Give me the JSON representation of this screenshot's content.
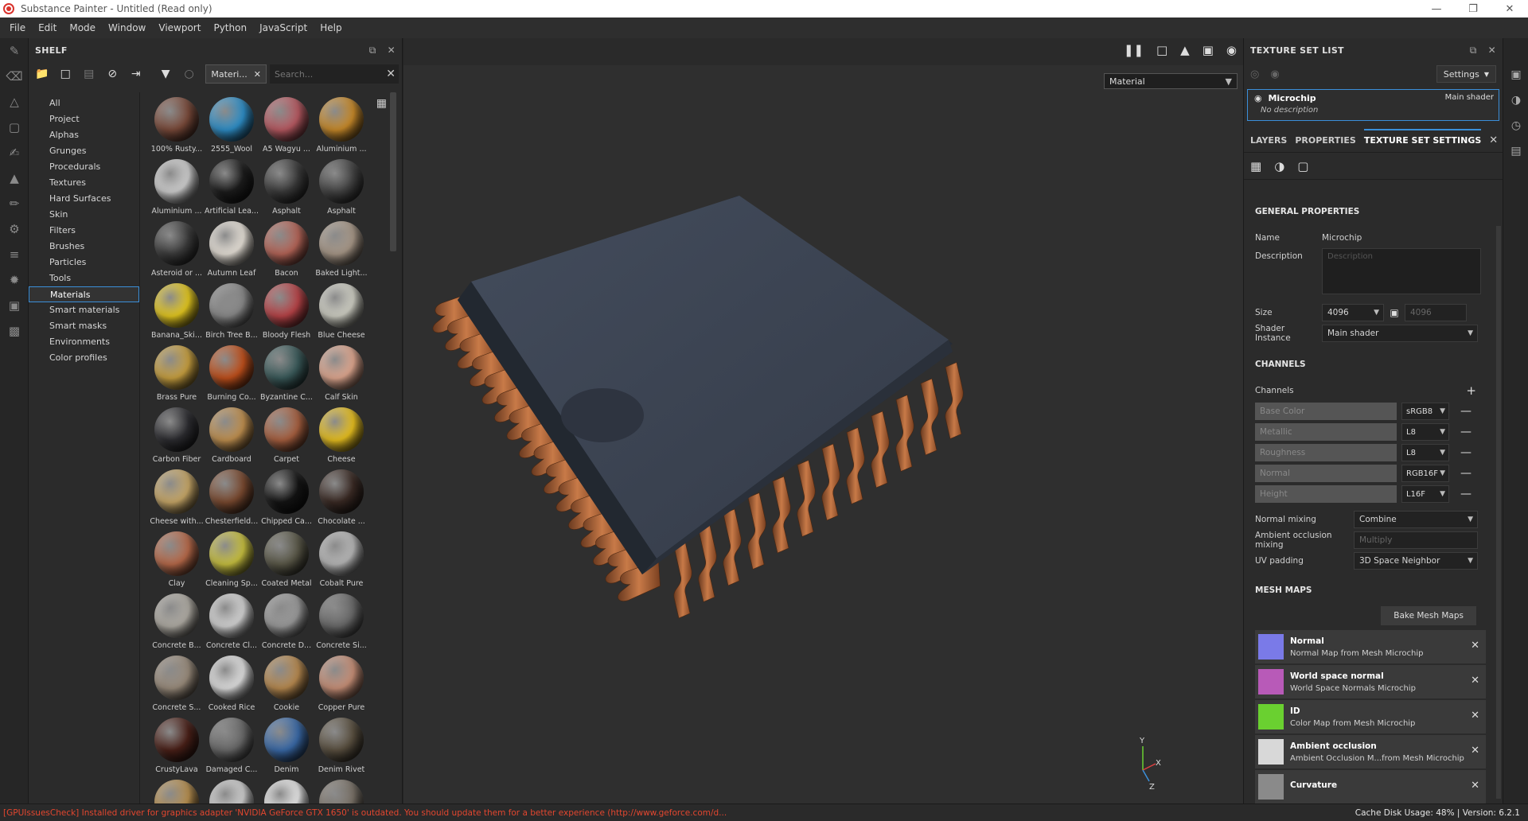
{
  "window": {
    "title": "Substance Painter - Untitled (Read only)"
  },
  "menu": [
    "File",
    "Edit",
    "Mode",
    "Window",
    "Viewport",
    "Python",
    "JavaScript",
    "Help"
  ],
  "shelf": {
    "title": "SHELF",
    "filter_chip": "Materi...",
    "search_placeholder": "Search...",
    "categories": [
      "All",
      "Project",
      "Alphas",
      "Grunges",
      "Procedurals",
      "Textures",
      "Hard Surfaces",
      "Skin",
      "Filters",
      "Brushes",
      "Particles",
      "Tools",
      "Materials",
      "Smart materials",
      "Smart masks",
      "Environments",
      "Color profiles"
    ],
    "active_category": "Materials",
    "materials": [
      {
        "label": "100% Rusty...",
        "color": "#7a4a3a"
      },
      {
        "label": "2555_Wool",
        "color": "#2f8fc8"
      },
      {
        "label": "A5 Wagyu ...",
        "color": "#b85a62"
      },
      {
        "label": "Aluminium ...",
        "color": "#c88a2a"
      },
      {
        "label": "Aluminium ...",
        "color": "#cfcfcf"
      },
      {
        "label": "Artificial Lea...",
        "color": "#1c1c1c"
      },
      {
        "label": "Asphalt",
        "color": "#3a3a3a"
      },
      {
        "label": "Asphalt",
        "color": "#444444"
      },
      {
        "label": "Asteroid or ...",
        "color": "#3c3c3c"
      },
      {
        "label": "Autumn Leaf",
        "color": "#e7e1d8"
      },
      {
        "label": "Bacon",
        "color": "#b56558"
      },
      {
        "label": "Baked Light...",
        "color": "#a89888"
      },
      {
        "label": "Banana_Ski...",
        "color": "#e4c820"
      },
      {
        "label": "Birch Tree B...",
        "color": "#8a8a8a"
      },
      {
        "label": "Bloody Flesh",
        "color": "#b84448"
      },
      {
        "label": "Blue Cheese",
        "color": "#cfcfc4"
      },
      {
        "label": "Brass Pure",
        "color": "#c8a040"
      },
      {
        "label": "Burning Co...",
        "color": "#c0501c"
      },
      {
        "label": "Byzantine C...",
        "color": "#3a5a5a"
      },
      {
        "label": "Calf Skin",
        "color": "#e0a890"
      },
      {
        "label": "Carbon Fiber",
        "color": "#2c2c30"
      },
      {
        "label": "Cardboard",
        "color": "#c09050"
      },
      {
        "label": "Carpet",
        "color": "#a86040"
      },
      {
        "label": "Cheese",
        "color": "#e8c020"
      },
      {
        "label": "Cheese with...",
        "color": "#c8a868"
      },
      {
        "label": "Chesterfield...",
        "color": "#7a4a30"
      },
      {
        "label": "Chipped Ca...",
        "color": "#141414"
      },
      {
        "label": "Chocolate ...",
        "color": "#3a2a24"
      },
      {
        "label": "Clay",
        "color": "#b86a4a"
      },
      {
        "label": "Cleaning Sp...",
        "color": "#c8c040"
      },
      {
        "label": "Coated Metal",
        "color": "#5a5848"
      },
      {
        "label": "Cobalt Pure",
        "color": "#b8b8b8"
      },
      {
        "label": "Concrete B...",
        "color": "#b0aca4"
      },
      {
        "label": "Concrete Cl...",
        "color": "#d4d4d4"
      },
      {
        "label": "Concrete D...",
        "color": "#9a9a9a"
      },
      {
        "label": "Concrete Si...",
        "color": "#6a6a6a"
      },
      {
        "label": "Concrete S...",
        "color": "#9a8c7c"
      },
      {
        "label": "Cooked Rice",
        "color": "#e0e0e0"
      },
      {
        "label": "Cookie",
        "color": "#b88a50"
      },
      {
        "label": "Copper Pure",
        "color": "#c89078"
      },
      {
        "label": "CrustyLava",
        "color": "#4a2018"
      },
      {
        "label": "Damaged C...",
        "color": "#6a6a6a"
      },
      {
        "label": "Denim",
        "color": "#3a6aa8"
      },
      {
        "label": "Denim Rivet",
        "color": "#5a5040"
      },
      {
        "label": "",
        "color": "#b89050"
      },
      {
        "label": "",
        "color": "#cfcfcf"
      },
      {
        "label": "",
        "color": "#e8e8e8"
      },
      {
        "label": "",
        "color": "#7a7268"
      }
    ]
  },
  "viewport": {
    "mode_select": "Material",
    "axis_x": "X",
    "axis_y": "Y",
    "axis_z": "Z"
  },
  "texture_set_list": {
    "title": "TEXTURE SET LIST",
    "settings_label": "Settings",
    "item_name": "Microchip",
    "item_shader": "Main shader",
    "item_desc": "No description"
  },
  "tabs": {
    "layers": "LAYERS",
    "properties": "PROPERTIES",
    "tss": "TEXTURE SET SETTINGS"
  },
  "general": {
    "title": "GENERAL PROPERTIES",
    "name_label": "Name",
    "name_value": "Microchip",
    "description_label": "Description",
    "description_placeholder": "Description",
    "size_label": "Size",
    "size_value": "4096",
    "size_locked_value": "4096",
    "shader_label": "Shader Instance",
    "shader_value": "Main shader"
  },
  "channels": {
    "title": "CHANNELS",
    "label": "Channels",
    "rows": [
      {
        "name": "Base Color",
        "format": "sRGB8"
      },
      {
        "name": "Metallic",
        "format": "L8"
      },
      {
        "name": "Roughness",
        "format": "L8"
      },
      {
        "name": "Normal",
        "format": "RGB16F"
      },
      {
        "name": "Height",
        "format": "L16F"
      }
    ],
    "normal_mixing_label": "Normal mixing",
    "normal_mixing_value": "Combine",
    "ao_mixing_label": "Ambient occlusion mixing",
    "ao_mixing_value": "Multiply",
    "uv_padding_label": "UV padding",
    "uv_padding_value": "3D Space Neighbor"
  },
  "mesh_maps": {
    "title": "MESH MAPS",
    "bake_label": "Bake Mesh Maps",
    "items": [
      {
        "title": "Normal",
        "sub": "Normal Map from Mesh Microchip",
        "color": "#7a7ae8"
      },
      {
        "title": "World space normal",
        "sub": "World Space Normals Microchip",
        "color": "#b85ab8"
      },
      {
        "title": "ID",
        "sub": "Color Map from Mesh Microchip",
        "color": "#6ad030"
      },
      {
        "title": "Ambient occlusion",
        "sub": "Ambient Occlusion M...from Mesh Microchip",
        "color": "#d8d8d8"
      },
      {
        "title": "Curvature",
        "sub": "",
        "color": "#8a8a8a"
      }
    ]
  },
  "status": {
    "error": "[GPUIssuesCheck] Installed driver for graphics adapter 'NVIDIA GeForce GTX 1650' is outdated. You should update them for a better experience (http://www.geforce.com/d...",
    "cache": "Cache Disk Usage:    48% | Version: 6.2.1"
  },
  "colors": {
    "accent": "#3b8fd9",
    "error": "#e2462f",
    "copper": "#b86a3c",
    "chip_body": "#3a4250"
  }
}
